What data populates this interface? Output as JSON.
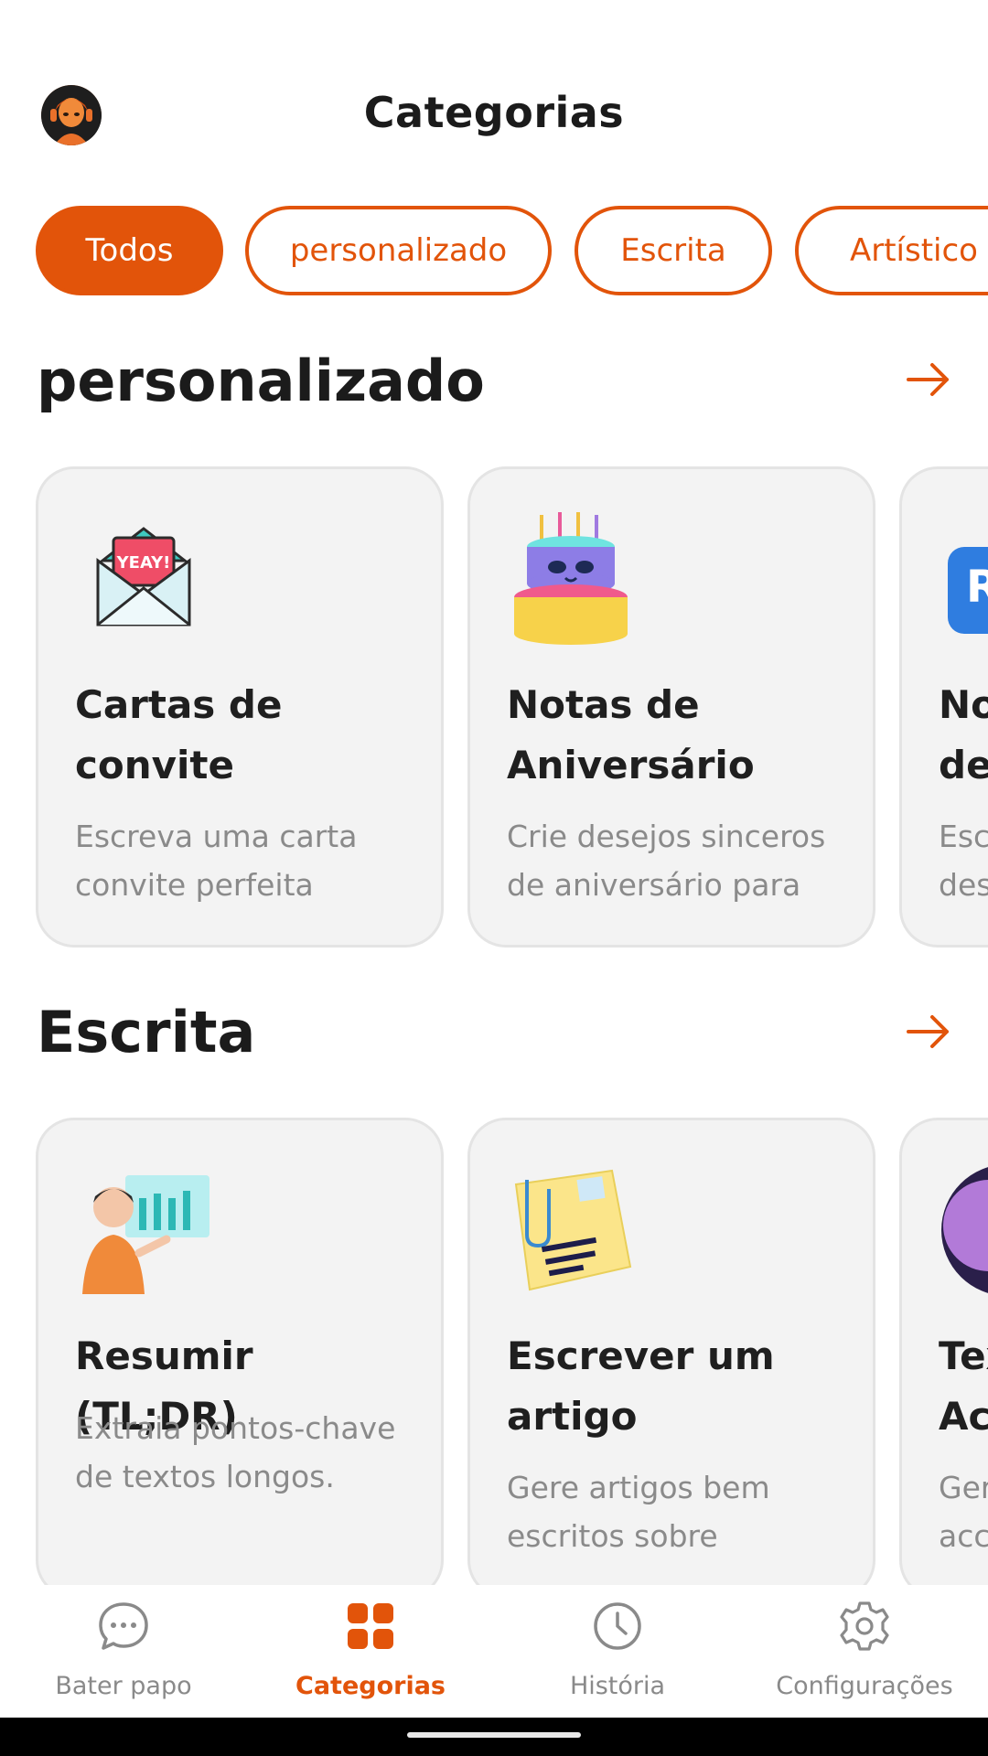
{
  "header": {
    "title": "Categorias"
  },
  "chips": [
    {
      "label": "Todos",
      "active": true
    },
    {
      "label": "personalizado"
    },
    {
      "label": "Escrita"
    },
    {
      "label": "Artístico"
    }
  ],
  "sections": [
    {
      "title": "personalizado",
      "cards": [
        {
          "title": "Cartas de convite",
          "description": "Escreva uma carta convite perfeita",
          "icon": "envelope-yeay-icon"
        },
        {
          "title": "Notas de Aniversário",
          "description": "Crie desejos sinceros de aniversário para",
          "icon": "birthday-cake-icon"
        },
        {
          "title": "No de",
          "description": "Esc des",
          "icon": "partial-card-icon"
        }
      ]
    },
    {
      "title": "Escrita",
      "cards": [
        {
          "title": "Resumir (TL;DR)",
          "description": "Extraia pontos-chave de textos longos.",
          "icon": "presenter-chart-icon"
        },
        {
          "title": "Escrever um artigo",
          "description": "Gere artigos bem escritos sobre",
          "icon": "sticky-note-icon"
        },
        {
          "title": "Tex Ac",
          "description": "Ger acc",
          "icon": "purple-avatar-icon"
        }
      ]
    }
  ],
  "nav": [
    {
      "label": "Bater papo",
      "icon": "chat-bubble-icon"
    },
    {
      "label": "Categorias",
      "icon": "grid-icon",
      "active": true
    },
    {
      "label": "História",
      "icon": "clock-icon"
    },
    {
      "label": "Configurações",
      "icon": "gear-icon"
    }
  ],
  "colors": {
    "accent": "#e2540a",
    "card_bg": "#f3f3f3",
    "muted_text": "#8a8a8a"
  }
}
